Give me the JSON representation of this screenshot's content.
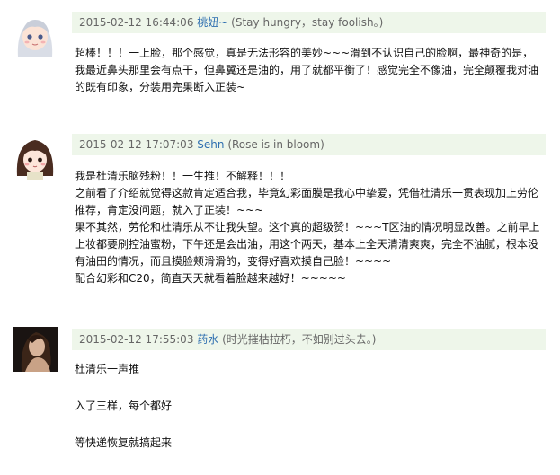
{
  "comments": [
    {
      "avatar_icon": "cartoon-girl-silver-hair-avatar",
      "date": "2015-02-12 16:44:06",
      "username": "桃妞~",
      "signature": "(Stay hungry，stay foolish。)",
      "paragraphs": [
        "超棒！！！一上脸，那个感觉，真是无法形容的美妙~~~滑到不认识自己的脸啊，最神奇的是，我最近鼻头那里会有点干，但鼻翼还是油的，用了就都平衡了！感觉完全不像油，完全颠覆我对油的既有印象，分装用完果断入正装~"
      ]
    },
    {
      "avatar_icon": "cartoon-girl-brown-hair-avatar",
      "date": "2015-02-12 17:07:03",
      "username": "Sehn",
      "signature": "(Rose is in bloom)",
      "paragraphs": [
        "我是杜清乐脑残粉！！一生推！不解释！！！",
        "之前看了介绍就觉得这款肯定适合我，毕竟幻彩面膜是我心中挚爱，凭借杜清乐一贯表现加上劳伦推荐，肯定没问题，就入了正装！~~~",
        "果不其然，劳伦和杜清乐从不让我失望。这个真的超级赞！~~~T区油的情况明显改善。之前早上上妆都要刷控油蜜粉，下午还是会出油，用这个两天，基本上全天清清爽爽，完全不油腻，根本没有油田的情况，而且摸脸颊滑滑的，变得好喜欢摸自己脸！~~~~",
        "配合幻彩和C20，简直天天就看着脸越来越好！~~~~~"
      ]
    },
    {
      "avatar_icon": "dark-photo-woman-avatar",
      "date": "2015-02-12 17:55:03",
      "username": "药水",
      "signature": "(时光摧枯拉朽，不如别过头去。)",
      "paragraphs": [
        "杜清乐一声推",
        "入了三样，每个都好",
        "等快递恢复就搞起来"
      ]
    }
  ]
}
